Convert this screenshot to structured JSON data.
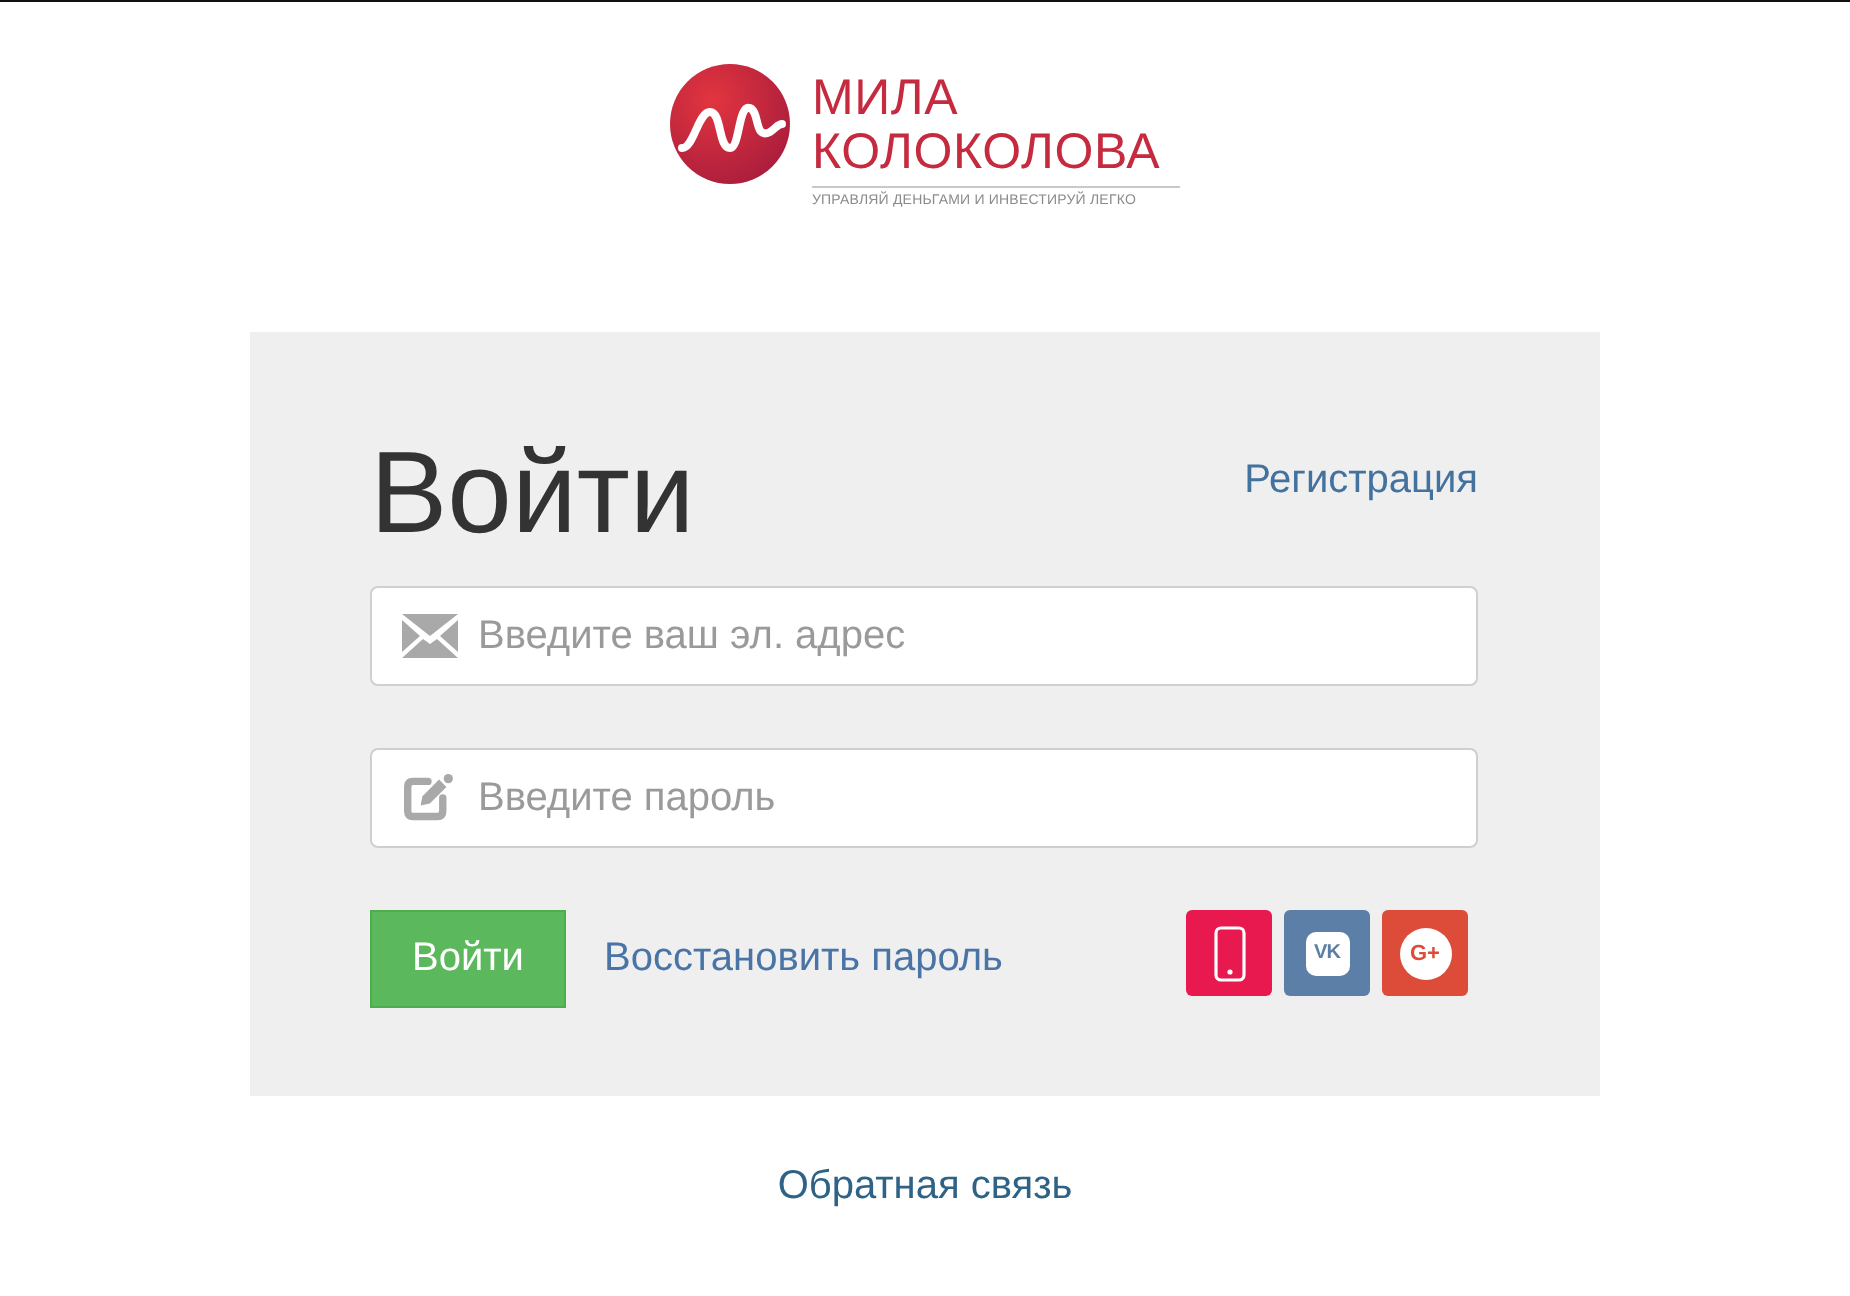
{
  "logo": {
    "name_line_1": "МИЛА",
    "name_line_2": "КОЛОКОЛОВА",
    "tagline": "УПРАВЛЯЙ ДЕНЬГАМИ И ИНВЕСТИРУЙ ЛЕГКО"
  },
  "login_form": {
    "title": "Войти",
    "register_link": "Регистрация",
    "fields": [
      {
        "kind": "email",
        "placeholder": "Введите ваш эл. адрес"
      },
      {
        "kind": "password",
        "placeholder": "Введите пароль"
      }
    ],
    "submit_button": "Войти",
    "recover_link": "Восстановить пароль",
    "social_buttons": [
      {
        "kind": "phone",
        "color": "#e8194f"
      },
      {
        "kind": "vk",
        "color": "#5b7fa6",
        "glyph": "VK"
      },
      {
        "kind": "google_plus",
        "color": "#dd4b39",
        "glyph": "G+"
      }
    ]
  },
  "feedback_link": "Обратная связь"
}
